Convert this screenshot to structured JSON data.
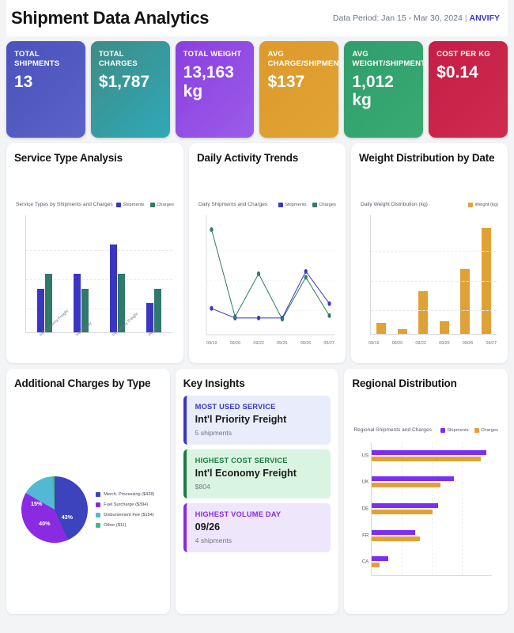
{
  "header": {
    "title": "Shipment Data Analytics",
    "period": "Data Period: Jan 15 - Mar 30, 2024",
    "separator": "|",
    "brand": "ANVIFY"
  },
  "kpis": [
    {
      "label": "TOTAL SHIPMENTS",
      "value": "13",
      "color_start": "#4a53bc",
      "color_end": "#5b62c9"
    },
    {
      "label": "TOTAL CHARGES",
      "value": "$1,787",
      "color_start": "#3f8c86",
      "color_end": "#2fa9b8"
    },
    {
      "label": "TOTAL WEIGHT",
      "value": "13,163 kg",
      "color_start": "#8a3fe0",
      "color_end": "#9b5ce8"
    },
    {
      "label": "AVG CHARGE/SHIPMENT",
      "value": "$137",
      "color_start": "#dd9a2a",
      "color_end": "#e0a436"
    },
    {
      "label": "AVG WEIGHT/SHIPMENT",
      "value": "1,012 kg",
      "color_start": "#2f9e6b",
      "color_end": "#3aaa74"
    },
    {
      "label": "COST PER KG",
      "value": "$0.14",
      "color_start": "#c41e46",
      "color_end": "#cf2a50"
    }
  ],
  "cards": {
    "service_type": {
      "title": "Service Type Analysis"
    },
    "daily_activity": {
      "title": "Daily Activity Trends"
    },
    "weight_distribution": {
      "title": "Weight Distribution by Date"
    },
    "additional_charges": {
      "title": "Additional Charges by Type"
    },
    "key_insights": {
      "title": "Key Insights"
    },
    "regional": {
      "title": "Regional Distribution"
    }
  },
  "insights": [
    {
      "kicker": "MOST USED SERVICE",
      "value": "Int'l Priority Freight",
      "sub": "5 shipments",
      "accent": "#3b35c4",
      "bg": "#e8ecfb"
    },
    {
      "kicker": "HIGHEST COST SERVICE",
      "value": "Int'l Economy Freight",
      "sub": "$804",
      "accent": "#1f7a46",
      "bg": "#d9f5e2"
    },
    {
      "kicker": "HIGHEST VOLUME DAY",
      "value": "09/26",
      "sub": "4 shipments",
      "accent": "#8a2be2",
      "bg": "#eee6fb"
    }
  ],
  "chart_data": [
    {
      "id": "service_type",
      "type": "bar",
      "title": "Service Type Analysis",
      "subtitle": "Service Types by Shipments and Charges",
      "categories": [
        "Int'l Economy Freight",
        "Int'l Priority",
        "Int'l Priority Freight",
        "Priority"
      ],
      "series": [
        {
          "name": "Shipments",
          "color": "#3b35c4",
          "values": [
            3,
            4,
            6,
            2
          ]
        },
        {
          "name": "Charges",
          "color": "#2f7a6a",
          "values": [
            4,
            3,
            4,
            3
          ]
        }
      ],
      "ylim": [
        0,
        8
      ],
      "grid": true,
      "legend_position": "top-right",
      "xlabel": "",
      "ylabel": ""
    },
    {
      "id": "daily_activity",
      "type": "line",
      "title": "Daily Activity Trends",
      "subtitle": "Daily Shipments and Charges",
      "x": [
        "09/19",
        "09/20",
        "09/22",
        "09/25",
        "09/26",
        "09/27"
      ],
      "tick_labels": [
        "09/19",
        "09/20",
        "09/22",
        "09/25",
        "09/26",
        "09/27"
      ],
      "series": [
        {
          "name": "Shipments",
          "color": "#3b35c4",
          "values": [
            2.2,
            1.4,
            1.4,
            1.4,
            5.3,
            2.6
          ]
        },
        {
          "name": "Charges",
          "color": "#2f7a6a",
          "values": [
            8.8,
            1.5,
            5.1,
            1.3,
            4.8,
            1.6
          ]
        }
      ],
      "ylim": [
        0,
        10
      ],
      "grid": true,
      "legend_position": "top-right"
    },
    {
      "id": "weight_distribution",
      "type": "bar",
      "title": "Weight Distribution by Date",
      "subtitle": "Daily Weight Distribution (kg)",
      "categories": [
        "09/19",
        "09/20",
        "09/22",
        "09/25",
        "09/26",
        "09/27"
      ],
      "series": [
        {
          "name": "Weight (kg)",
          "color": "#e0a236",
          "values": [
            0.9,
            0.4,
            3.4,
            1.0,
            5.2,
            8.5
          ]
        }
      ],
      "ylim": [
        0,
        9.5
      ],
      "grid": true,
      "legend_position": "top-right"
    },
    {
      "id": "additional_charges",
      "type": "pie",
      "title": "Additional Charges by Type",
      "labels": [
        "Merch. Processing ($428)",
        "Fuel Surcharge ($394)",
        "Disbursement Fee ($154)",
        "Other ($11)"
      ],
      "values": [
        428,
        394,
        154,
        11
      ],
      "display_percents": [
        "43%",
        "40%",
        "15%",
        ""
      ],
      "colors": [
        "#3b43bd",
        "#8a2be2",
        "#52b9d4",
        "#46b981"
      ],
      "legend_position": "right"
    },
    {
      "id": "regional",
      "type": "bar",
      "orientation": "horizontal",
      "title": "Regional Distribution",
      "subtitle": "Regional Shipments and Charges",
      "categories": [
        "US",
        "UK",
        "DE",
        "FR",
        "CA"
      ],
      "series": [
        {
          "name": "Shipments",
          "color": "#7b2ff2",
          "values": [
            100,
            72,
            58,
            38,
            14
          ]
        },
        {
          "name": "Charges",
          "color": "#e0a236",
          "values": [
            95,
            60,
            53,
            42,
            7
          ]
        }
      ],
      "grid": true,
      "legend_position": "top-right"
    }
  ]
}
